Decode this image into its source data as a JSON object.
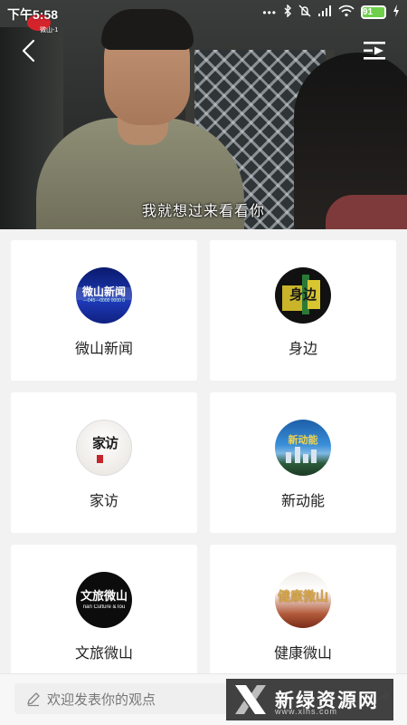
{
  "status_bar": {
    "time": "下午5:58",
    "battery": "91"
  },
  "video": {
    "channel_logo_text": "微山-1",
    "subtitle": "我就想过来看看你"
  },
  "grid": {
    "items": [
      {
        "label": "微山新闻",
        "thumb_text": "微山新闻",
        "thumb_sub": "—045—0000 0000 0"
      },
      {
        "label": "身边",
        "thumb_text": "身边"
      },
      {
        "label": "家访",
        "thumb_text": "家访"
      },
      {
        "label": "新动能",
        "thumb_text": "新动能"
      },
      {
        "label": "文旅微山",
        "thumb_text": "文旅微山",
        "thumb_sub": "nan Culture &Tou"
      },
      {
        "label": "健康微山",
        "thumb_text": "健康微山"
      }
    ]
  },
  "bottom_bar": {
    "comment_placeholder": "欢迎发表你的观点",
    "watermark_text": "新绿资源网",
    "watermark_url": "www.xlhs.com"
  },
  "colors": {
    "page_bg": "#f2f2f2",
    "card_bg": "#ffffff",
    "battery_fill": "#6fcf4a"
  }
}
